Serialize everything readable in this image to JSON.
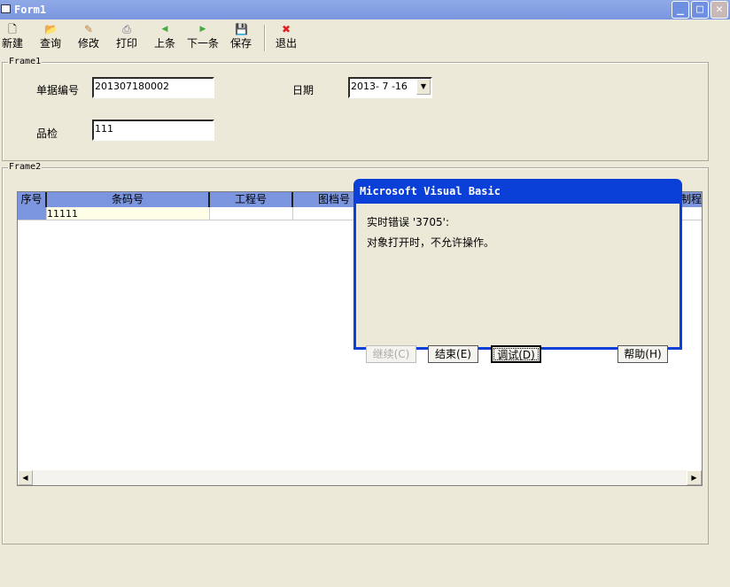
{
  "window": {
    "title": "Form1",
    "min": "_",
    "max": "□",
    "close": "✕"
  },
  "toolbar": [
    {
      "label": "新建",
      "icon": "new-icon",
      "glyph": "🗋"
    },
    {
      "label": "查询",
      "icon": "open-folder-icon",
      "glyph": "📂"
    },
    {
      "label": "修改",
      "icon": "pencil-icon",
      "glyph": "✎"
    },
    {
      "label": "打印",
      "icon": "printer-icon",
      "glyph": "⎙"
    },
    {
      "label": "上条",
      "icon": "arrow-left-icon",
      "glyph": "◀"
    },
    {
      "label": "下一条",
      "icon": "arrow-right-icon",
      "glyph": "▶"
    },
    {
      "label": "保存",
      "icon": "save-icon",
      "glyph": "💾"
    },
    {
      "label": "退出",
      "icon": "exit-icon",
      "glyph": "✖"
    }
  ],
  "frame1": {
    "title": "Frame1",
    "doc_no_label": "单据编号",
    "doc_no": "201307180002",
    "date_label": "日期",
    "date": "2013- 7 -16",
    "qc_label": "品检",
    "qc": "111"
  },
  "frame2": {
    "title": "Frame2",
    "grid": {
      "headers": [
        "序号",
        "条码号",
        "工程号",
        "图档号",
        "制程"
      ],
      "row": [
        "",
        "11111",
        "",
        ""
      ]
    }
  },
  "dialog": {
    "title": "Microsoft Visual Basic",
    "error": "实时错误 '3705':",
    "message": "对象打开时，不允许操作。",
    "continue": "继续(C)",
    "end": "结束(E)",
    "debug": "调试(D)",
    "help": "帮助(H)"
  },
  "colors": {
    "title": "#7a96df",
    "header": "#7b96df",
    "dialog": "#0a3fd8"
  }
}
